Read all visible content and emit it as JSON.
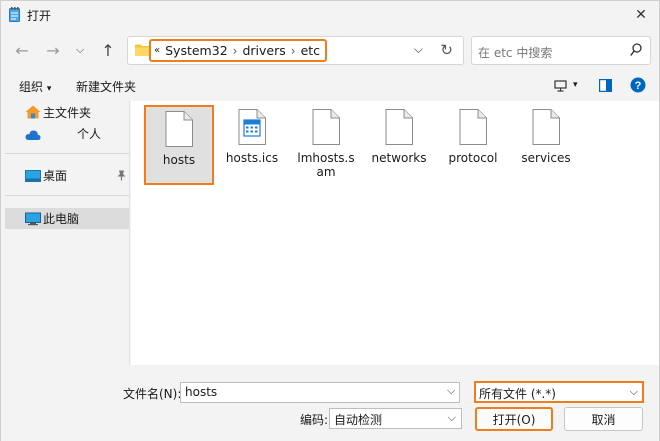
{
  "window": {
    "title": "打开",
    "close_glyph": "✕"
  },
  "nav": {
    "back_glyph": "←",
    "forward_glyph": "→",
    "recent_glyph": "⌵",
    "up_glyph": "↑",
    "crumb_overflow": "«",
    "crumbs": [
      "System32",
      "drivers",
      "etc"
    ],
    "crumb_sep": "›",
    "dropdown_glyph": "⌵",
    "refresh_glyph": "↻",
    "search_placeholder": "在 etc 中搜索"
  },
  "command_bar": {
    "organize": "组织",
    "organize_caret": "▾",
    "new_folder": "新建文件夹",
    "view_caret": "▾",
    "help_glyph": "?"
  },
  "nav_pane": {
    "home": "主文件夹",
    "cloud": "个人",
    "desktop": "桌面",
    "this_pc": "此电脑"
  },
  "files": [
    {
      "name": "hosts",
      "type": "blank"
    },
    {
      "name": "hosts.ics",
      "type": "calendar"
    },
    {
      "name": "lmhosts.sam",
      "type": "blank"
    },
    {
      "name": "networks",
      "type": "blank"
    },
    {
      "name": "protocol",
      "type": "blank"
    },
    {
      "name": "services",
      "type": "blank"
    }
  ],
  "bottom": {
    "filename_label": "文件名(N):",
    "filename_value": "hosts",
    "filetype_value": "所有文件  (*.*)",
    "encoding_label": "编码:",
    "encoding_value": "自动检测",
    "dropdown_glyph": "⌵",
    "open_button": "打开(O)",
    "cancel_button": "取消"
  },
  "colors": {
    "highlight": "#f07c1c",
    "accent": "#0067c0"
  }
}
